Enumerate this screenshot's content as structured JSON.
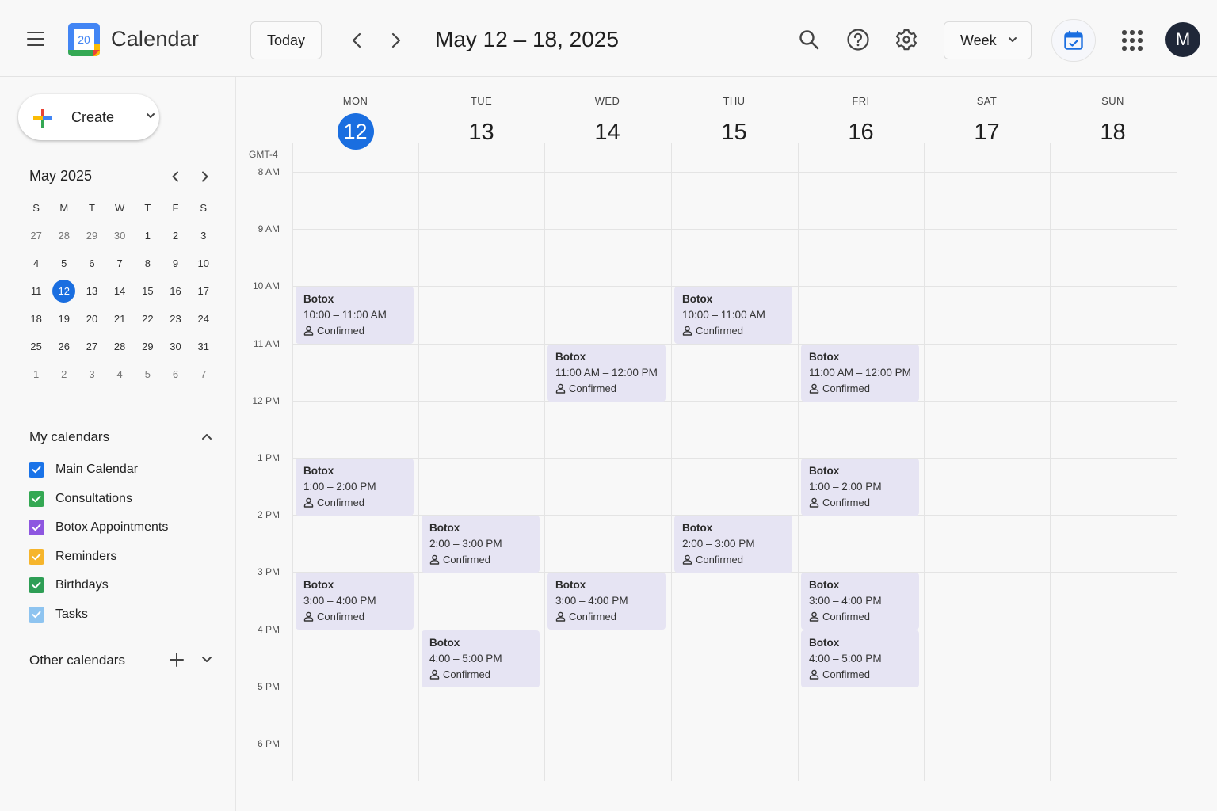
{
  "header": {
    "app_title": "Calendar",
    "logo_text": "20",
    "today_label": "Today",
    "date_range": "May 12 – 18, 2025",
    "view_label": "Week",
    "avatar_initial": "M"
  },
  "colors": {
    "accent": "#1a6ee0",
    "event_bg": "#e6e4f3"
  },
  "sidebar": {
    "create_label": "Create",
    "mini_title": "May 2025",
    "weekday_initials": [
      "S",
      "M",
      "T",
      "W",
      "T",
      "F",
      "S"
    ],
    "selected_day": "12",
    "weeks": [
      [
        {
          "d": "27",
          "m": true
        },
        {
          "d": "28",
          "m": true
        },
        {
          "d": "29",
          "m": true
        },
        {
          "d": "30",
          "m": true
        },
        {
          "d": "1"
        },
        {
          "d": "2"
        },
        {
          "d": "3"
        }
      ],
      [
        {
          "d": "4"
        },
        {
          "d": "5"
        },
        {
          "d": "6"
        },
        {
          "d": "7"
        },
        {
          "d": "8"
        },
        {
          "d": "9"
        },
        {
          "d": "10"
        }
      ],
      [
        {
          "d": "11"
        },
        {
          "d": "12",
          "sel": true
        },
        {
          "d": "13"
        },
        {
          "d": "14"
        },
        {
          "d": "15"
        },
        {
          "d": "16"
        },
        {
          "d": "17"
        }
      ],
      [
        {
          "d": "18"
        },
        {
          "d": "19"
        },
        {
          "d": "20"
        },
        {
          "d": "21"
        },
        {
          "d": "22"
        },
        {
          "d": "23"
        },
        {
          "d": "24"
        }
      ],
      [
        {
          "d": "25"
        },
        {
          "d": "26"
        },
        {
          "d": "27"
        },
        {
          "d": "28"
        },
        {
          "d": "29"
        },
        {
          "d": "30"
        },
        {
          "d": "31"
        }
      ],
      [
        {
          "d": "1",
          "m": true
        },
        {
          "d": "2",
          "m": true
        },
        {
          "d": "3",
          "m": true
        },
        {
          "d": "4",
          "m": true
        },
        {
          "d": "5",
          "m": true
        },
        {
          "d": "6",
          "m": true
        },
        {
          "d": "7",
          "m": true
        }
      ]
    ],
    "my_calendars_title": "My calendars",
    "my_calendars": [
      {
        "name": "Main Calendar",
        "color": "#1a73e8"
      },
      {
        "name": "Consultations",
        "color": "#34a853"
      },
      {
        "name": "Botox Appointments",
        "color": "#8e57e0"
      },
      {
        "name": "Reminders",
        "color": "#f6b52c"
      },
      {
        "name": "Birthdays",
        "color": "#2e9e55"
      },
      {
        "name": "Tasks",
        "color": "#8ec4f0"
      }
    ],
    "other_calendars_title": "Other calendars"
  },
  "grid": {
    "timezone": "GMT-4",
    "days": [
      {
        "dow": "MON",
        "num": "12",
        "today": true
      },
      {
        "dow": "TUE",
        "num": "13"
      },
      {
        "dow": "WED",
        "num": "14"
      },
      {
        "dow": "THU",
        "num": "15"
      },
      {
        "dow": "FRI",
        "num": "16"
      },
      {
        "dow": "SAT",
        "num": "17"
      },
      {
        "dow": "SUN",
        "num": "18"
      }
    ],
    "hours": [
      "8 AM",
      "9 AM",
      "10 AM",
      "11 AM",
      "12 PM",
      "1 PM",
      "2 PM",
      "3 PM",
      "4 PM",
      "5 PM",
      "6 PM"
    ],
    "events": [
      {
        "day": 0,
        "start": 10,
        "title": "Botox",
        "time": "10:00 – 11:00 AM",
        "status": "Confirmed"
      },
      {
        "day": 3,
        "start": 10,
        "title": "Botox",
        "time": "10:00 – 11:00 AM",
        "status": "Confirmed"
      },
      {
        "day": 2,
        "start": 11,
        "title": "Botox",
        "time": "11:00 AM – 12:00 PM",
        "status": "Confirmed"
      },
      {
        "day": 4,
        "start": 11,
        "title": "Botox",
        "time": "11:00 AM – 12:00 PM",
        "status": "Confirmed"
      },
      {
        "day": 0,
        "start": 13,
        "title": "Botox",
        "time": "1:00 – 2:00 PM",
        "status": "Confirmed"
      },
      {
        "day": 4,
        "start": 13,
        "title": "Botox",
        "time": "1:00 – 2:00 PM",
        "status": "Confirmed"
      },
      {
        "day": 1,
        "start": 14,
        "title": "Botox",
        "time": "2:00 – 3:00 PM",
        "status": "Confirmed"
      },
      {
        "day": 3,
        "start": 14,
        "title": "Botox",
        "time": "2:00 – 3:00 PM",
        "status": "Confirmed"
      },
      {
        "day": 0,
        "start": 15,
        "title": "Botox",
        "time": "3:00 – 4:00 PM",
        "status": "Confirmed"
      },
      {
        "day": 2,
        "start": 15,
        "title": "Botox",
        "time": "3:00 – 4:00 PM",
        "status": "Confirmed"
      },
      {
        "day": 4,
        "start": 15,
        "title": "Botox",
        "time": "3:00 – 4:00 PM",
        "status": "Confirmed"
      },
      {
        "day": 1,
        "start": 16,
        "title": "Botox",
        "time": "4:00 – 5:00 PM",
        "status": "Confirmed"
      },
      {
        "day": 4,
        "start": 16,
        "title": "Botox",
        "time": "4:00 – 5:00 PM",
        "status": "Confirmed"
      }
    ]
  }
}
